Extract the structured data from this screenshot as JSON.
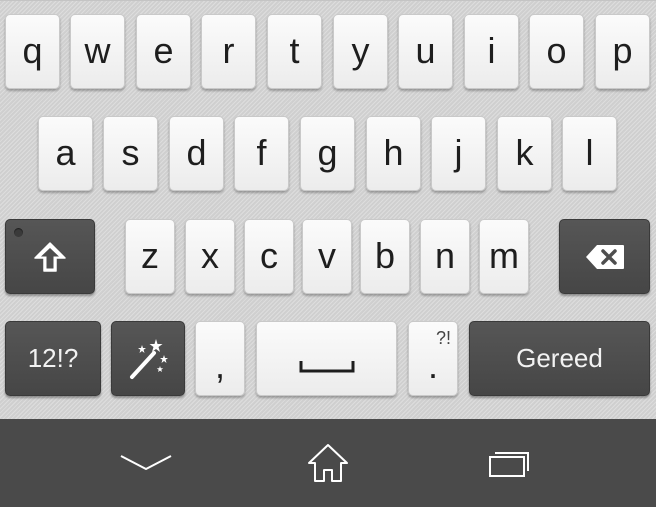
{
  "keyboard": {
    "rows": [
      [
        "q",
        "w",
        "e",
        "r",
        "t",
        "y",
        "u",
        "i",
        "o",
        "p"
      ],
      [
        "a",
        "s",
        "d",
        "f",
        "g",
        "h",
        "j",
        "k",
        "l"
      ],
      [
        "z",
        "x",
        "c",
        "v",
        "b",
        "n",
        "m"
      ]
    ],
    "shift_icon": "shift-arrow-icon",
    "backspace_icon": "backspace-icon",
    "symbols_label": "12!?",
    "magic_icon": "magic-wand-icon",
    "comma_label": ",",
    "space_icon": "space-bar-icon",
    "period_label": ".",
    "period_alt_label": "?!",
    "done_label": "Gereed"
  },
  "navbar": {
    "back_icon": "chevron-down-icon",
    "home_icon": "home-icon",
    "recents_icon": "recent-apps-icon"
  },
  "colors": {
    "keyboard_background": "#d6d6d6",
    "light_key": "#f5f5f5",
    "dark_key": "#4e4e4e",
    "navbar_background": "#4a4a4a"
  }
}
